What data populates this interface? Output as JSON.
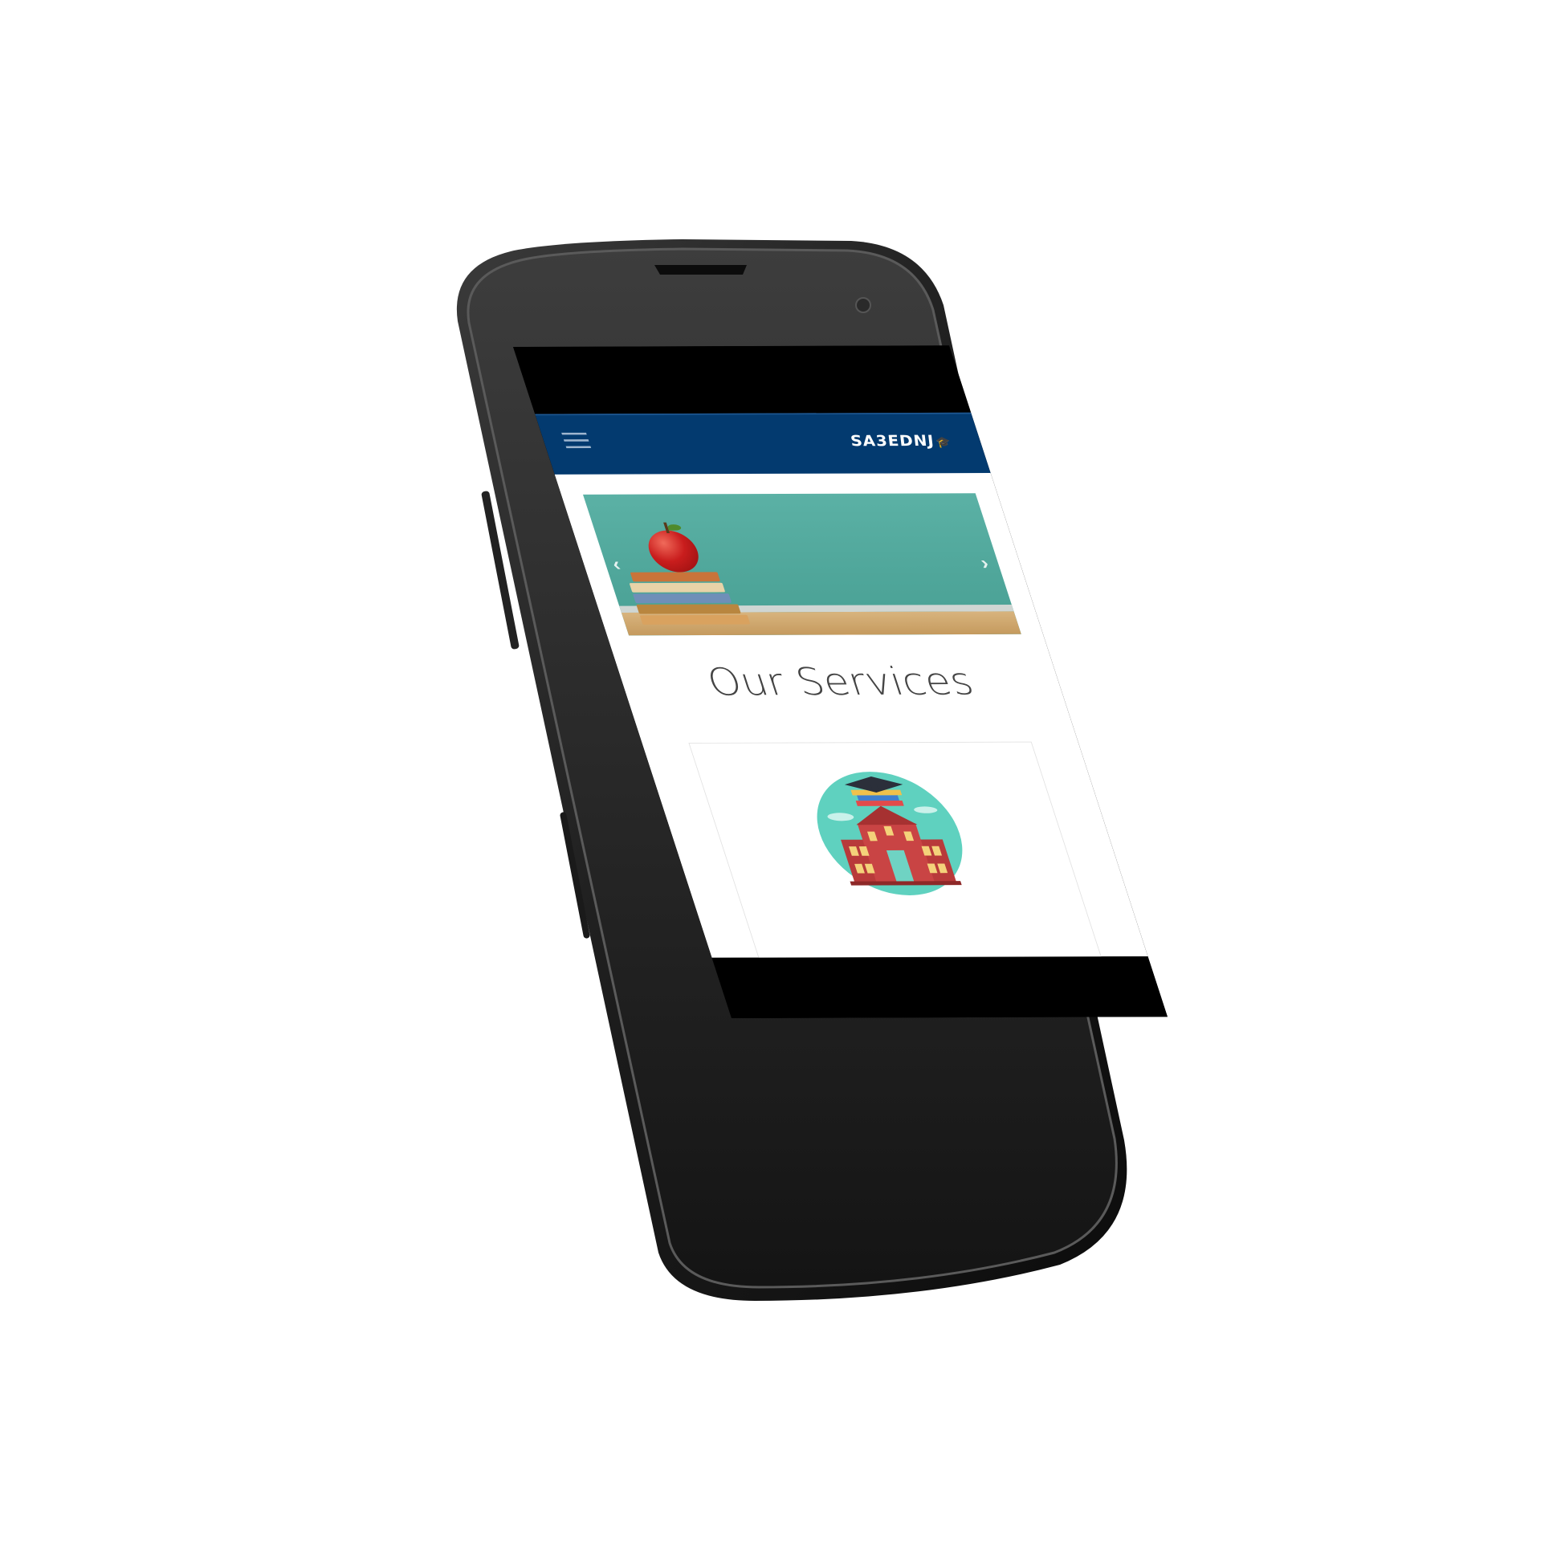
{
  "app": {
    "brand": "SA3EDNJ",
    "theme_color": "#033a6f"
  },
  "navigation": {
    "menu_icon": "hamburger-menu-icon"
  },
  "hero_carousel": {
    "prev_icon": "chevron-left-icon",
    "next_icon": "chevron-right-icon",
    "prev_glyph": "‹",
    "next_glyph": "›"
  },
  "services": {
    "title": "Our Services",
    "cards": [
      {
        "icon": "school-building-icon"
      }
    ]
  }
}
